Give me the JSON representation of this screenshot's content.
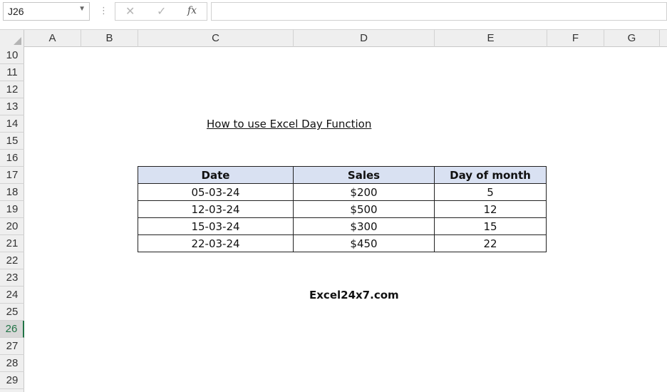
{
  "formula_bar": {
    "name_box": "J26",
    "formula": ""
  },
  "columns": [
    "A",
    "B",
    "C",
    "D",
    "E",
    "F",
    "G"
  ],
  "rows": [
    "10",
    "11",
    "12",
    "13",
    "14",
    "15",
    "16",
    "17",
    "18",
    "19",
    "20",
    "21",
    "22",
    "23",
    "24",
    "25",
    "26",
    "27",
    "28",
    "29"
  ],
  "active_row": "26",
  "sheet": {
    "title": "How to use Excel Day Function",
    "table": {
      "headers": [
        "Date",
        "Sales",
        "Day of month"
      ],
      "rows": [
        [
          "05-03-24",
          "$200",
          "5"
        ],
        [
          "12-03-24",
          "$500",
          "12"
        ],
        [
          "15-03-24",
          "$300",
          "15"
        ],
        [
          "22-03-24",
          "$450",
          "22"
        ]
      ]
    },
    "watermark": "Excel24x7.com"
  },
  "colors": {
    "header_fill": "#d9e1f2",
    "active_accent": "#217346",
    "headers_bg": "#efefef"
  },
  "icons": [
    "cancel-icon",
    "enter-icon",
    "function-icon",
    "select-all-icon"
  ]
}
